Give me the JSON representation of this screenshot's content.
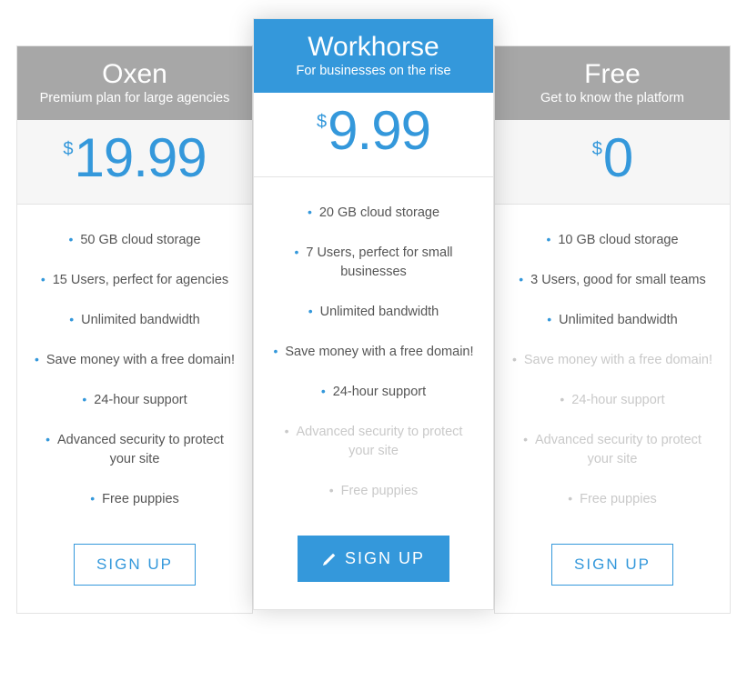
{
  "plans": [
    {
      "name": "Oxen",
      "subtitle": "Premium plan for large agencies",
      "currency": "$",
      "price": "19.99",
      "cta": "SIGN UP",
      "featured": false,
      "features": [
        {
          "text": "50 GB cloud storage",
          "muted": false
        },
        {
          "text": "15 Users, perfect for agencies",
          "muted": false
        },
        {
          "text": "Unlimited bandwidth",
          "muted": false
        },
        {
          "text": "Save money with a free domain!",
          "muted": false
        },
        {
          "text": "24-hour support",
          "muted": false
        },
        {
          "text": "Advanced security to protect your site",
          "muted": false
        },
        {
          "text": "Free puppies",
          "muted": false
        }
      ]
    },
    {
      "name": "Workhorse",
      "subtitle": "For businesses on the rise",
      "currency": "$",
      "price": "9.99",
      "cta": "SIGN UP",
      "featured": true,
      "features": [
        {
          "text": "20 GB cloud storage",
          "muted": false
        },
        {
          "text": "7 Users, perfect for small businesses",
          "muted": false
        },
        {
          "text": "Unlimited bandwidth",
          "muted": false
        },
        {
          "text": "Save money with a free domain!",
          "muted": false
        },
        {
          "text": "24-hour support",
          "muted": false
        },
        {
          "text": "Advanced security to protect your site",
          "muted": true
        },
        {
          "text": "Free puppies",
          "muted": true
        }
      ]
    },
    {
      "name": "Free",
      "subtitle": "Get to know the platform",
      "currency": "$",
      "price": "0",
      "cta": "SIGN UP",
      "featured": false,
      "features": [
        {
          "text": "10 GB cloud storage",
          "muted": false
        },
        {
          "text": "3 Users, good for small teams",
          "muted": false
        },
        {
          "text": "Unlimited bandwidth",
          "muted": false
        },
        {
          "text": "Save money with a free domain!",
          "muted": true
        },
        {
          "text": "24-hour support",
          "muted": true
        },
        {
          "text": "Advanced security to protect your site",
          "muted": true
        },
        {
          "text": "Free puppies",
          "muted": true
        }
      ]
    }
  ]
}
